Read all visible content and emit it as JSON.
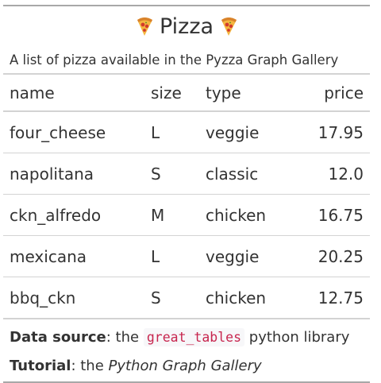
{
  "table": {
    "title": "Pizza",
    "title_icon": "pizza-emoji",
    "subtitle": "A list of pizza available in the Pyzza Graph Gallery",
    "columns": [
      "name",
      "size",
      "type",
      "price"
    ],
    "rows": [
      {
        "name": "four_cheese",
        "size": "L",
        "type": "veggie",
        "price": "17.95"
      },
      {
        "name": "napolitana",
        "size": "S",
        "type": "classic",
        "price": "12.0"
      },
      {
        "name": "ckn_alfredo",
        "size": "M",
        "type": "chicken",
        "price": "16.75"
      },
      {
        "name": "mexicana",
        "size": "L",
        "type": "veggie",
        "price": "20.25"
      },
      {
        "name": "bbq_ckn",
        "size": "S",
        "type": "chicken",
        "price": "12.75"
      }
    ]
  },
  "footer": {
    "source_label": "Data source",
    "source_prefix": ": the ",
    "source_code": "great_tables",
    "source_suffix": " python library",
    "tutorial_label": "Tutorial",
    "tutorial_prefix": ": the ",
    "tutorial_link": "Python Graph Gallery"
  },
  "colors": {
    "text": "#333333",
    "rule": "#d3d3d3",
    "outer_rule": "#a8a8a8",
    "code_text": "#c7254e"
  }
}
